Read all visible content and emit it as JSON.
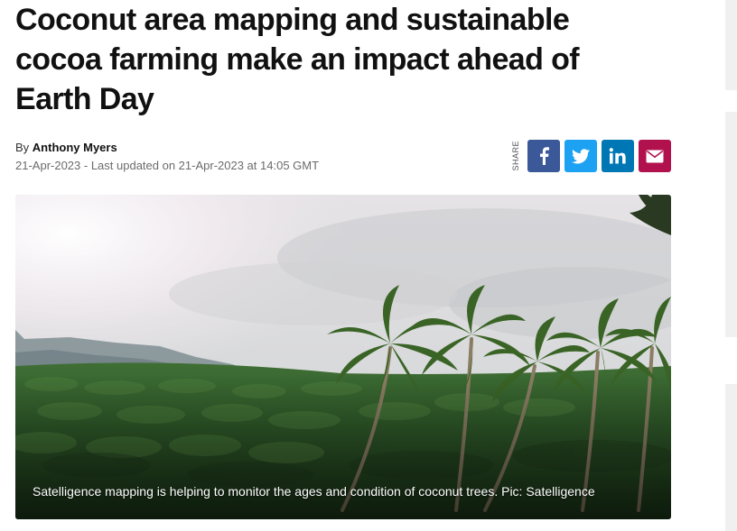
{
  "article": {
    "headline": "Coconut area mapping and sustainable cocoa farming make an impact ahead of Earth Day",
    "byline_prefix": "By",
    "author": "Anthony Myers",
    "dateline": "21-Apr-2023 - Last updated on 21-Apr-2023 at 14:05 GMT"
  },
  "share": {
    "label": "SHARE",
    "buttons": [
      {
        "name": "facebook",
        "icon": "facebook-icon",
        "color": "#3b5998"
      },
      {
        "name": "twitter",
        "icon": "twitter-icon",
        "color": "#1da1f2"
      },
      {
        "name": "linkedin",
        "icon": "linkedin-icon",
        "color": "#0077b5"
      },
      {
        "name": "email",
        "icon": "envelope-icon",
        "color": "#b1124e"
      }
    ]
  },
  "hero": {
    "caption": "Satelligence mapping is helping to monitor the ages and condition of coconut trees. Pic: Satelligence"
  }
}
